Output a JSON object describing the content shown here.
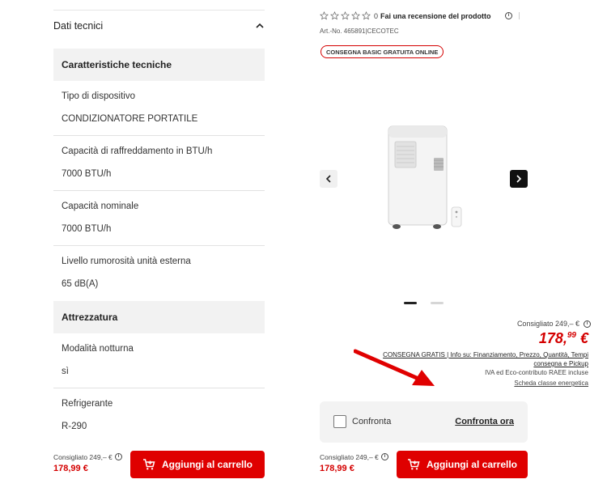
{
  "left": {
    "section_title": "Dati tecnici",
    "groups": [
      {
        "title": "Caratteristiche tecniche"
      },
      {
        "title": "Attrezzatura"
      }
    ],
    "specs": [
      {
        "label": "Tipo di dispositivo",
        "value": "CONDIZIONATORE PORTATILE"
      },
      {
        "label": "Capacità di raffreddamento in BTU/h",
        "value": "7000 BTU/h"
      },
      {
        "label": "Capacità nominale",
        "value": "7000 BTU/h"
      },
      {
        "label": "Livello rumorosità unità esterna",
        "value": "65 dB(A)"
      },
      {
        "label": "Modalità notturna",
        "value": "sì"
      },
      {
        "label": "Refrigerante",
        "value": "R-290"
      }
    ],
    "sticky": {
      "recommended": "Consigliato 249,– €",
      "price": "178,99 €",
      "cart_label": "Aggiungi al carrello"
    }
  },
  "right": {
    "rating_count": "0",
    "review_link": "Fai una recensione del prodotto",
    "artno": "Art.-No. 465891|CECOTEC",
    "badge": "CONSEGNA BASIC GRATUITA ONLINE",
    "carousel": {
      "slides": 2,
      "active": 1
    },
    "recommended": "Consigliato 249,– €",
    "price_main": "178,",
    "price_cents": "99",
    "price_currency": " €",
    "delivery_info": "CONSEGNA GRATIS | Info su: Finanziamento, Prezzo, Quantità, Tempi consegna e Pickup",
    "iva": "IVA ed Eco-contributo RAEE incluse",
    "energy_link": "Scheda classe energetica",
    "compare_label": "Confronta",
    "compare_now": "Confronta ora",
    "sticky": {
      "recommended": "Consigliato 249,– €",
      "price": "178,99 €",
      "cart_label": "Aggiungi al carrello"
    }
  },
  "colors": {
    "accent_red": "#df0000",
    "price_red": "#d40000",
    "panel_grey": "#f2f2f2"
  },
  "icons": [
    "chevron-up-icon",
    "star-icon",
    "info-icon",
    "cart-icon",
    "chevron-left-icon",
    "chevron-right-icon",
    "annotation-arrow"
  ]
}
